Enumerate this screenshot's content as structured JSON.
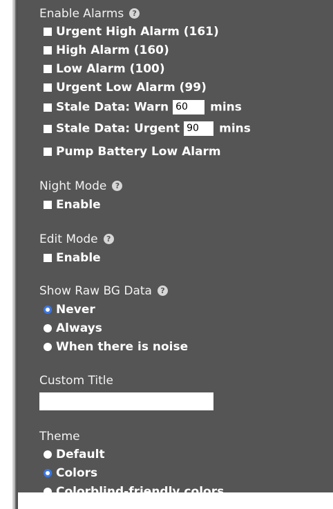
{
  "alarms": {
    "heading": "Enable Alarms",
    "help_icon": "help-circle-icon",
    "items": [
      {
        "label": "Urgent High Alarm (161)",
        "checked": false
      },
      {
        "label": "High Alarm (160)",
        "checked": false
      },
      {
        "label": "Low Alarm (100)",
        "checked": false
      },
      {
        "label": "Urgent Low Alarm (99)",
        "checked": false
      }
    ],
    "stale_warn": {
      "label": "Stale Data: Warn",
      "value": "60",
      "unit": "mins",
      "checked": false
    },
    "stale_urgent": {
      "label": "Stale Data: Urgent",
      "value": "90",
      "unit": "mins",
      "checked": false
    },
    "pump_battery": {
      "label": "Pump Battery Low Alarm",
      "checked": false
    }
  },
  "night_mode": {
    "heading": "Night Mode",
    "enable_label": "Enable",
    "checked": false
  },
  "edit_mode": {
    "heading": "Edit Mode",
    "enable_label": "Enable",
    "checked": false
  },
  "raw_bg": {
    "heading": "Show Raw BG Data",
    "options": [
      {
        "label": "Never",
        "selected": true
      },
      {
        "label": "Always",
        "selected": false
      },
      {
        "label": "When there is noise",
        "selected": false
      }
    ]
  },
  "custom_title": {
    "heading": "Custom Title",
    "value": ""
  },
  "theme": {
    "heading": "Theme",
    "options": [
      {
        "label": "Default",
        "selected": false
      },
      {
        "label": "Colors",
        "selected": true
      },
      {
        "label": "Colorblind-friendly colors",
        "selected": false
      }
    ]
  },
  "colors": {
    "panel_bg": "#555555",
    "selected_radio": "#3b78e7"
  }
}
